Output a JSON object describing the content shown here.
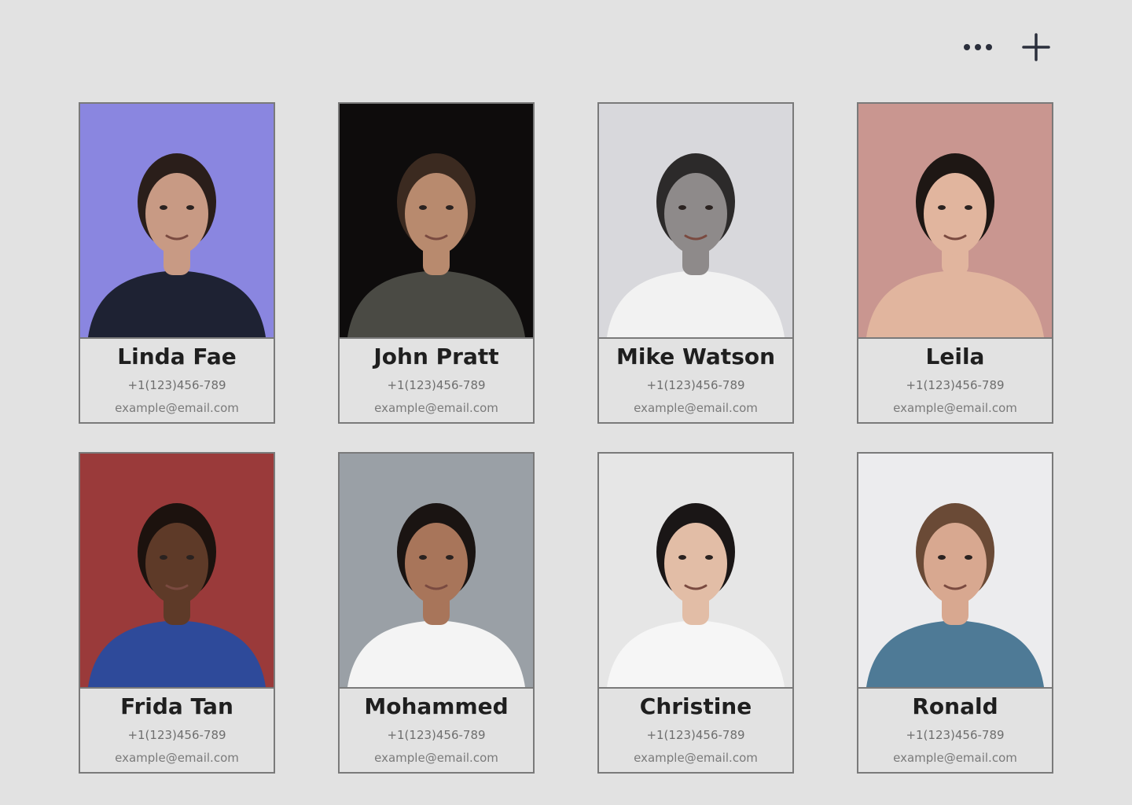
{
  "toolbar": {
    "more_icon": "more-horizontal-icon",
    "add_icon": "plus-icon"
  },
  "contacts": [
    {
      "name": "Linda Fae",
      "phone": "+1(123)456-789",
      "email": "example@email.com",
      "bg": "#8a86e0",
      "skin": "#c89a84",
      "hair": "#2a1e1a",
      "shirt": "#1e2233"
    },
    {
      "name": "John Pratt",
      "phone": "+1(123)456-789",
      "email": "example@email.com",
      "bg": "#0e0c0c",
      "skin": "#b88a6e",
      "hair": "#3b2a20",
      "shirt": "#4a4a44"
    },
    {
      "name": "Mike Watson",
      "phone": "+1(123)456-789",
      "email": "example@email.com",
      "bg": "#d8d8dc",
      "skin": "#8e8a8a",
      "hair": "#2c2a2a",
      "shirt": "#f2f2f2"
    },
    {
      "name": "Leila",
      "phone": "+1(123)456-789",
      "email": "example@email.com",
      "bg": "#c99690",
      "skin": "#e1b59e",
      "hair": "#1e1714",
      "shirt": "#e1b59e"
    },
    {
      "name": "Frida Tan",
      "phone": "+1(123)456-789",
      "email": "example@email.com",
      "bg": "#9a3a3a",
      "skin": "#5e3a28",
      "hair": "#1c120e",
      "shirt": "#2e4a9a"
    },
    {
      "name": "Mohammed",
      "phone": "+1(123)456-789",
      "email": "example@email.com",
      "bg": "#9aa0a6",
      "skin": "#a8755a",
      "hair": "#1a1412",
      "shirt": "#f4f4f4"
    },
    {
      "name": "Christine",
      "phone": "+1(123)456-789",
      "email": "example@email.com",
      "bg": "#e6e6e6",
      "skin": "#e2bda6",
      "hair": "#1a1616",
      "shirt": "#f6f6f6"
    },
    {
      "name": "Ronald",
      "phone": "+1(123)456-789",
      "email": "example@email.com",
      "bg": "#ececee",
      "skin": "#d8a890",
      "hair": "#6a4a36",
      "shirt": "#4e7a96"
    }
  ]
}
